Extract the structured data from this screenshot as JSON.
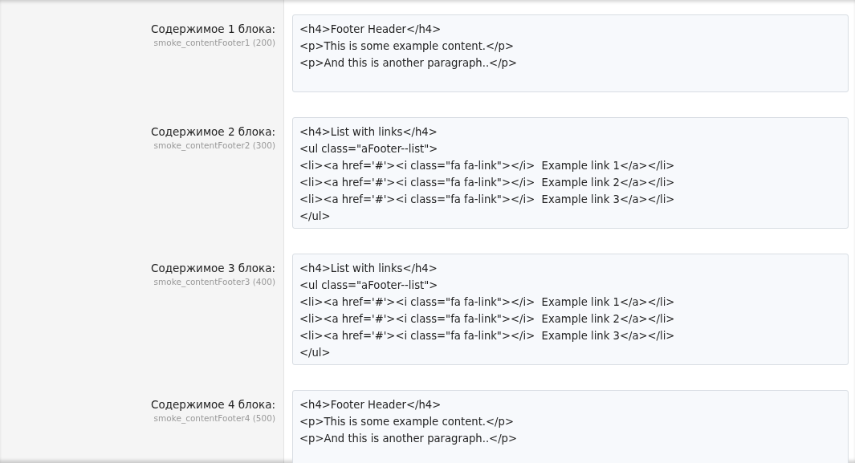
{
  "fields": [
    {
      "label": "Содержимое 1 блока:",
      "key": "smoke_contentFooter1 (200)",
      "value": [
        "<h4>Footer Header</h4>",
        "<p>This is some example content.</p>",
        "<p>And this is another paragraph..</p>"
      ]
    },
    {
      "label": "Содержимое 2 блока:",
      "key": "smoke_contentFooter2 (300)",
      "value": [
        "<h4>List with links</h4>",
        "<ul class=\"aFooter--list\">",
        "<li><a href='#'><i class=\"fa fa-link\"></i>  Example link 1</a></li>",
        "<li><a href='#'><i class=\"fa fa-link\"></i>  Example link 2</a></li>",
        "<li><a href='#'><i class=\"fa fa-link\"></i>  Example link 3</a></li>",
        "</ul>"
      ]
    },
    {
      "label": "Содержимое 3 блока:",
      "key": "smoke_contentFooter3 (400)",
      "value": [
        "<h4>List with links</h4>",
        "<ul class=\"aFooter--list\">",
        "<li><a href='#'><i class=\"fa fa-link\"></i>  Example link 1</a></li>",
        "<li><a href='#'><i class=\"fa fa-link\"></i>  Example link 2</a></li>",
        "<li><a href='#'><i class=\"fa fa-link\"></i>  Example link 3</a></li>",
        "</ul>"
      ]
    },
    {
      "label": "Содержимое 4 блока:",
      "key": "smoke_contentFooter4 (500)",
      "value": [
        "<h4>Footer Header</h4>",
        "<p>This is some example content.</p>",
        "<p>And this is another paragraph..</p>"
      ]
    }
  ]
}
